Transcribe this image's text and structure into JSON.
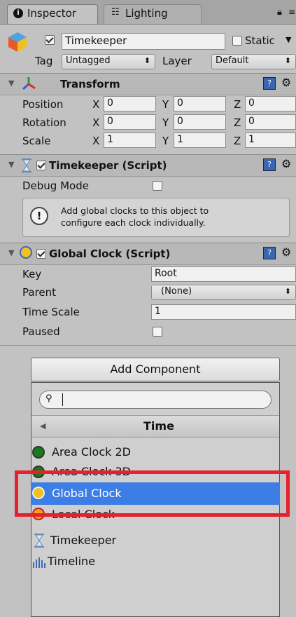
{
  "tabs": [
    {
      "label": "Inspector"
    },
    {
      "label": "Lighting"
    }
  ],
  "object": {
    "name": "Timekeeper",
    "static_label": "Static",
    "tag_label": "Tag",
    "tag_value": "Untagged",
    "layer_label": "Layer",
    "layer_value": "Default"
  },
  "transform": {
    "title": "Transform",
    "rows": [
      {
        "label": "Position",
        "x": "0",
        "y": "0",
        "z": "0"
      },
      {
        "label": "Rotation",
        "x": "0",
        "y": "0",
        "z": "0"
      },
      {
        "label": "Scale",
        "x": "1",
        "y": "1",
        "z": "1"
      }
    ],
    "axis": {
      "x": "X",
      "y": "Y",
      "z": "Z"
    }
  },
  "timekeeper_script": {
    "title": "Timekeeper (Script)",
    "debug_label": "Debug Mode",
    "help_line1": "Add global clocks to this object to",
    "help_line2": "configure each clock individually."
  },
  "global_clock_script": {
    "title": "Global Clock (Script)",
    "key_label": "Key",
    "key_value": "Root",
    "parent_label": "Parent",
    "parent_value": "(None)",
    "timescale_label": "Time Scale",
    "timescale_value": "1",
    "paused_label": "Paused"
  },
  "add_component": {
    "button": "Add Component",
    "search_value": "",
    "category": "Time",
    "items": [
      {
        "label": "Area Clock 2D"
      },
      {
        "label": "Area Clock 3D"
      },
      {
        "label": "Global Clock"
      },
      {
        "label": "Local Clock"
      },
      {
        "label": "Timekeeper"
      },
      {
        "label": "Timeline"
      }
    ]
  },
  "colors": {
    "selection": "#3d7ee6",
    "highlight_box": "#e8202a"
  }
}
